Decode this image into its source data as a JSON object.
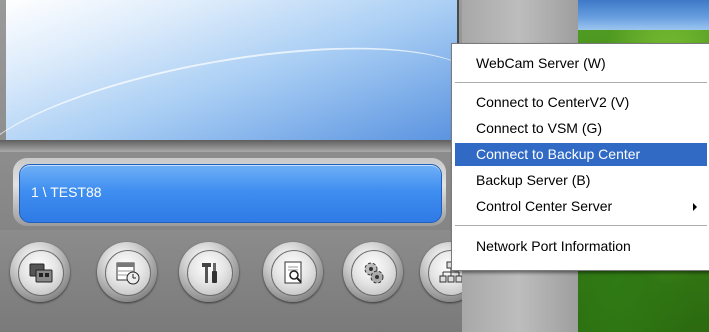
{
  "status_field": {
    "text": "1 \\ TEST88"
  },
  "toolbar": {
    "buttons": [
      {
        "icon": "device-card-icon"
      },
      {
        "icon": "calendar-clock-icon"
      },
      {
        "icon": "tools-icon"
      },
      {
        "icon": "search-document-icon"
      },
      {
        "icon": "gear-sync-icon"
      },
      {
        "icon": "network-icon"
      }
    ]
  },
  "context_menu": {
    "items": [
      {
        "label": "WebCam Server (W)"
      },
      {
        "label": "Connect to CenterV2 (V)"
      },
      {
        "label": "Connect to VSM (G)"
      },
      {
        "label": "Connect to Backup Center",
        "highlighted": true
      },
      {
        "label": "Backup Server (B)"
      },
      {
        "label": "Control Center Server",
        "has_submenu": true
      },
      {
        "label": "Network Port Information"
      }
    ],
    "highlight_color": "#316ac5"
  }
}
